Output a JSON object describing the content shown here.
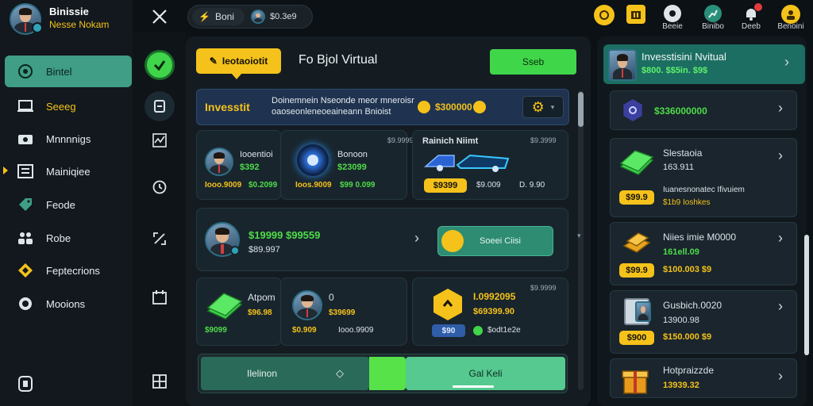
{
  "sidebar": {
    "user_name": "Binissie",
    "user_sub": "Nesse Nokam",
    "items": [
      {
        "label": "Bintel",
        "icon": "compass-icon",
        "active": true
      },
      {
        "label": "Seeeg",
        "icon": "laptop-icon"
      },
      {
        "label": "Mnnnnigs",
        "icon": "camera-icon"
      },
      {
        "label": "Mainiqiee",
        "icon": "list-icon"
      },
      {
        "label": "Feode",
        "icon": "tag-icon"
      },
      {
        "label": "Robe",
        "icon": "people-icon"
      },
      {
        "label": "Feptecrions",
        "icon": "diamond-icon"
      },
      {
        "label": "Mooions",
        "icon": "globe-icon"
      }
    ]
  },
  "topbar": {
    "tab1": "Boni",
    "tab2": "$0.3e9",
    "icons": [
      {
        "label": "",
        "icon": "coin-icon"
      },
      {
        "label": "",
        "icon": "briefcase-icon"
      },
      {
        "label": "Beeie",
        "icon": "headset-icon"
      },
      {
        "label": "Binibo",
        "icon": "chart-icon"
      },
      {
        "label": "Deeb",
        "icon": "bell-icon"
      },
      {
        "label": "Benoini",
        "icon": "user-icon"
      }
    ]
  },
  "main": {
    "tab_active": "Ieotaoiotit",
    "heading": "Fo Bjol Virtual",
    "green_button": "Sseb",
    "banner": {
      "label": "Invesstit",
      "line1": "Doinemnein Nseonde meor mneroisr",
      "line2": "oaoseonleneoeaineann Bnioist",
      "amount": "$300000"
    },
    "row1": [
      {
        "name": "Iooentioi",
        "value": "$392",
        "v1": "Iooo.9009",
        "v2": "$0.2099"
      },
      {
        "name": "Bonoon",
        "value": "$23099",
        "tag": "$9.9999",
        "v1": "Ioos.9009",
        "v2": "$99 0.099"
      },
      {
        "name": "Rainich Niimt",
        "tag": "$9.3999",
        "pill": "$9399",
        "v1": "$9.009",
        "v2": "D. 9.90"
      }
    ],
    "mid": {
      "title": "$19999 $99559",
      "sub": "$89.997",
      "button": "Soeei Ciisi"
    },
    "row3": [
      {
        "name": "Atpom",
        "v1": "$96.98",
        "v2": "$9099"
      },
      {
        "name": "0",
        "v1": "$39699",
        "v2": "$0.909",
        "v3": "Iooo.9909"
      },
      {
        "title": "I.0992095",
        "tag": "$9.9999",
        "sub": "$69399.90",
        "pill": "$90",
        "note": "$odt1e2e"
      }
    ],
    "bottom": {
      "left": "Ilelinon",
      "right": "Gal Keli"
    }
  },
  "right": {
    "top": {
      "title": "Invesstisini Nvitual",
      "sub": "$800. $$5in. $9$"
    },
    "items": [
      {
        "title": "$336000000",
        "icon": "shield-icon"
      },
      {
        "title": "Slestaoia",
        "sub": "163.911",
        "pill": "$99.9",
        "line1": "Iuanesnonatec Ifivuiem",
        "line2": "$1b9 Ioshkes"
      },
      {
        "title": "Niies imie M0000",
        "sub": "161ell.09",
        "pill": "$99.9",
        "line1": "$100.003 $9"
      },
      {
        "title": "Gusbich.0020",
        "sub": "13900.98",
        "pill": "$900",
        "line1": "$150.000 $9"
      },
      {
        "title": "Hotpraizzde",
        "sub": "13939.32"
      }
    ]
  },
  "colors": {
    "accent": "#3f9e85",
    "green": "#4fdc4a",
    "yellow": "#f4c21a",
    "bg": "#0c1116"
  }
}
